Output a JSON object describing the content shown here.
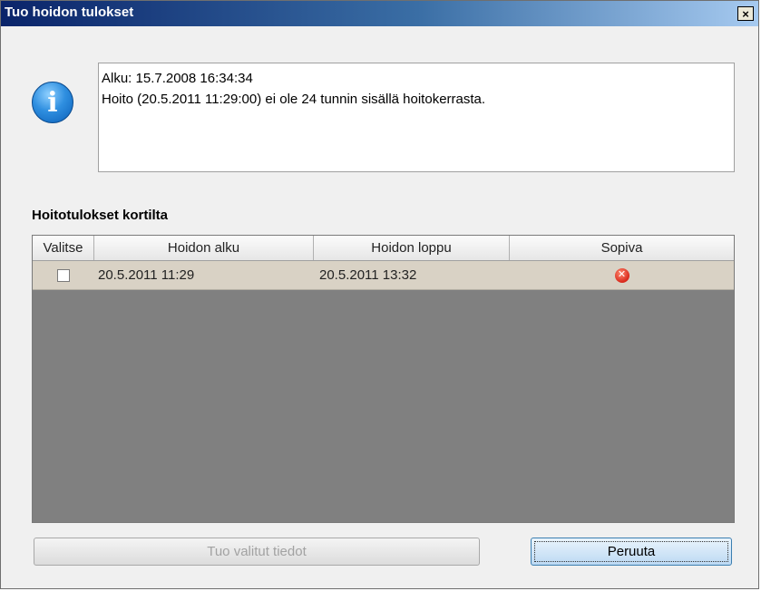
{
  "window": {
    "title": "Tuo hoidon tulokset",
    "close_symbol": "×"
  },
  "message": {
    "icon": "info-icon",
    "lines": [
      "Alku: 15.7.2008 16:34:34",
      "Hoito (20.5.2011 11:29:00) ei ole 24 tunnin sisällä hoitokerrasta."
    ]
  },
  "section": {
    "label": "Hoitotulokset kortilta"
  },
  "grid": {
    "columns": [
      "Valitse",
      "Hoidon alku",
      "Hoidon loppu",
      "Sopiva"
    ],
    "rows": [
      {
        "selected": false,
        "start": "20.5.2011 11:29",
        "end": "20.5.2011 13:32",
        "suitable_icon": "error-icon"
      }
    ]
  },
  "buttons": {
    "import_label": "Tuo valitut tiedot",
    "import_enabled": false,
    "cancel_label": "Peruuta"
  },
  "colors": {
    "grid_background": "#808080",
    "row_background": "#d9d2c5",
    "error": "#d8281b"
  }
}
